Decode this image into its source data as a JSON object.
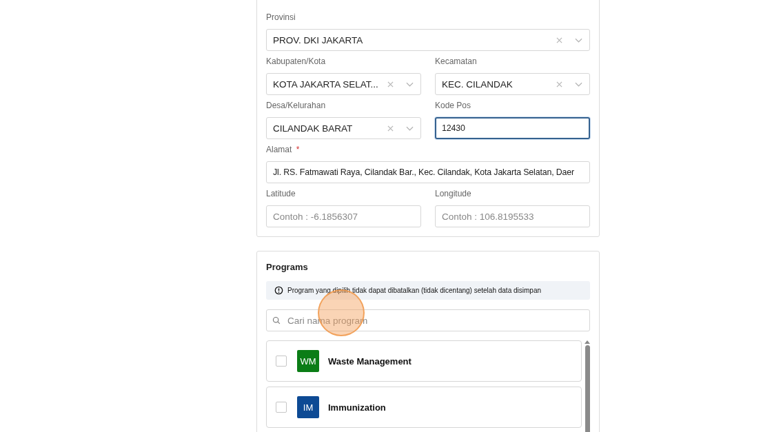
{
  "location": {
    "rows": [
      [
        {
          "label": "Provinsi",
          "kind": "select",
          "value": "PROV. DKI JAKARTA"
        }
      ],
      [
        {
          "label": "Kabupaten/Kota",
          "kind": "select",
          "value": "KOTA JAKARTA SELAT..."
        },
        {
          "label": "Kecamatan",
          "kind": "select",
          "value": "KEC. CILANDAK"
        }
      ],
      [
        {
          "label": "Desa/Kelurahan",
          "kind": "select",
          "value": "CILANDAK BARAT"
        },
        {
          "label": "Kode Pos",
          "kind": "text",
          "value": "12430",
          "focused": true
        }
      ],
      [
        {
          "label": "Alamat",
          "required_mark": "*",
          "kind": "text",
          "value": "Jl. RS. Fatmawati Raya, Cilandak Bar., Kec. Cilandak, Kota Jakarta Selatan, Daer",
          "focused": false
        }
      ],
      [
        {
          "label": "Latitude",
          "kind": "text",
          "placeholder": "Contoh : -6.1856307",
          "focused": false
        },
        {
          "label": "Longitude",
          "kind": "text",
          "placeholder": "Contoh : 106.8195533",
          "focused": false
        }
      ]
    ]
  },
  "programs": {
    "title": "Programs",
    "notice": "Program yang dipilih tidak dapat dibatalkan (tidak dicentang) setelah data disimpan",
    "search": {
      "placeholder": "Cari nama program"
    },
    "items": [
      {
        "code": "WM",
        "color": "#0b7d16",
        "name": "Waste Management",
        "checked": false
      },
      {
        "code": "IM",
        "color": "#0d4a94",
        "name": "Immunization",
        "checked": false
      }
    ]
  }
}
